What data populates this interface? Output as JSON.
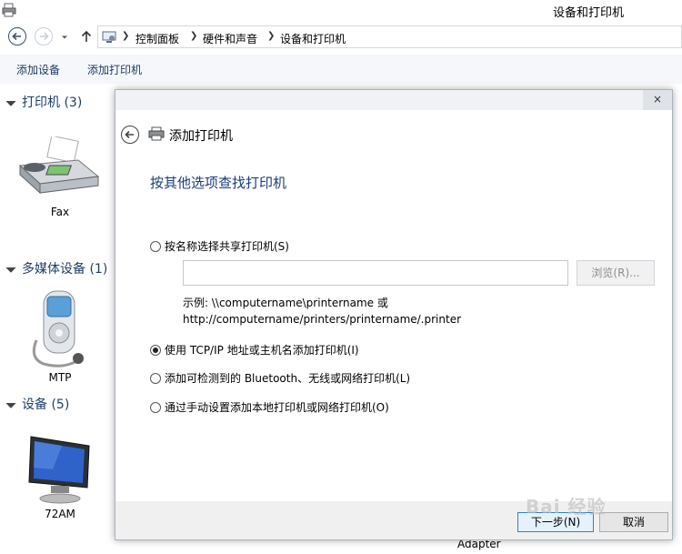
{
  "window": {
    "title": "设备和打印机"
  },
  "breadcrumb": [
    "控制面板",
    "硬件和声音",
    "设备和打印机"
  ],
  "toolbar": {
    "add_device": "添加设备",
    "add_printer": "添加打印机"
  },
  "groups": [
    {
      "header": "打印机 (3)",
      "devices": [
        "Fax"
      ]
    },
    {
      "header": "多媒体设备 (1)",
      "devices": [
        "MTP"
      ]
    },
    {
      "header": "设备 (5)",
      "devices": [
        "72AM"
      ]
    }
  ],
  "behind_label": "Adapter",
  "dialog": {
    "title": "添加打印机",
    "heading": "按其他选项查找打印机",
    "options": [
      {
        "label": "按名称选择共享打印机(S)",
        "checked": false
      },
      {
        "label": "使用 TCP/IP 地址或主机名添加打印机(I)",
        "checked": true
      },
      {
        "label": "添加可检测到的 Bluetooth、无线或网络打印机(L)",
        "checked": false
      },
      {
        "label": "通过手动设置添加本地打印机或网络打印机(O)",
        "checked": false
      }
    ],
    "share_input_value": "",
    "browse_label": "浏览(R)...",
    "example_line1": "示例: \\\\computername\\printername 或",
    "example_line2": "http://computername/printers/printername/.printer",
    "next_label": "下一步(N)",
    "cancel_label": "取消",
    "close_label": "×"
  },
  "watermark": "Bai 经验",
  "colors": {
    "link_blue": "#1e3d6b",
    "heading_blue": "#1a3e7a",
    "accent": "#3c7fb1"
  }
}
